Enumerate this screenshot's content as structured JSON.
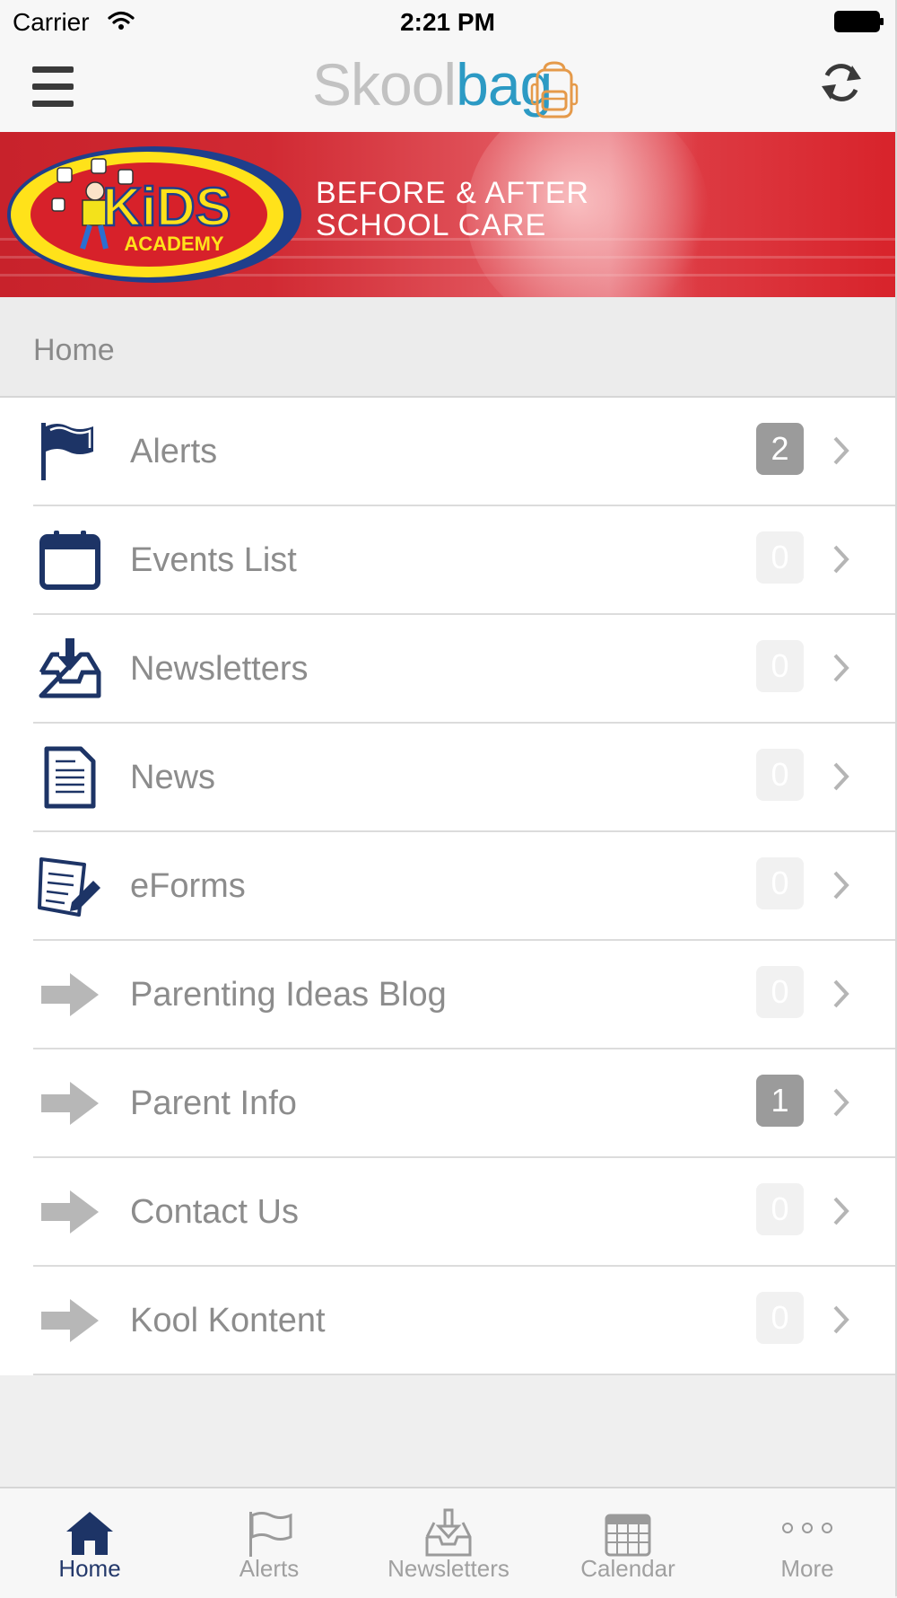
{
  "status_bar": {
    "carrier": "Carrier",
    "time": "2:21 PM"
  },
  "nav": {
    "logo_part1": "Skool",
    "logo_part2": "bag"
  },
  "banner": {
    "logo_top": "KiDS",
    "logo_bottom": "ACADEMY",
    "line1": "BEFORE & AFTER",
    "line2": "SCHOOL CARE"
  },
  "section": {
    "title": "Home"
  },
  "menu": [
    {
      "label": "Alerts",
      "count": "2",
      "icon": "flag-icon",
      "highlight": true
    },
    {
      "label": "Events List",
      "count": "0",
      "icon": "calendar-icon",
      "highlight": false
    },
    {
      "label": "Newsletters",
      "count": "0",
      "icon": "inbox-download-icon",
      "highlight": false
    },
    {
      "label": "News",
      "count": "0",
      "icon": "document-icon",
      "highlight": false
    },
    {
      "label": "eForms",
      "count": "0",
      "icon": "form-pen-icon",
      "highlight": false
    },
    {
      "label": "Parenting Ideas Blog",
      "count": "0",
      "icon": "arrow-right-icon",
      "highlight": false
    },
    {
      "label": "Parent Info",
      "count": "1",
      "icon": "arrow-right-icon",
      "highlight": true
    },
    {
      "label": "Contact Us",
      "count": "0",
      "icon": "arrow-right-icon",
      "highlight": false
    },
    {
      "label": "Kool Kontent",
      "count": "0",
      "icon": "arrow-right-icon",
      "highlight": false
    }
  ],
  "tabs": [
    {
      "label": "Home",
      "icon": "home-icon",
      "active": true
    },
    {
      "label": "Alerts",
      "icon": "flag-icon",
      "active": false
    },
    {
      "label": "Newsletters",
      "icon": "inbox-download-icon",
      "active": false
    },
    {
      "label": "Calendar",
      "icon": "calendar-icon",
      "active": false
    },
    {
      "label": "More",
      "icon": "more-dots-icon",
      "active": false
    }
  ],
  "colors": {
    "brand_navy": "#1d3466",
    "logo_blue": "#2c9ac4",
    "banner_red": "#d8232b",
    "badge_active": "#9b9b9b"
  }
}
